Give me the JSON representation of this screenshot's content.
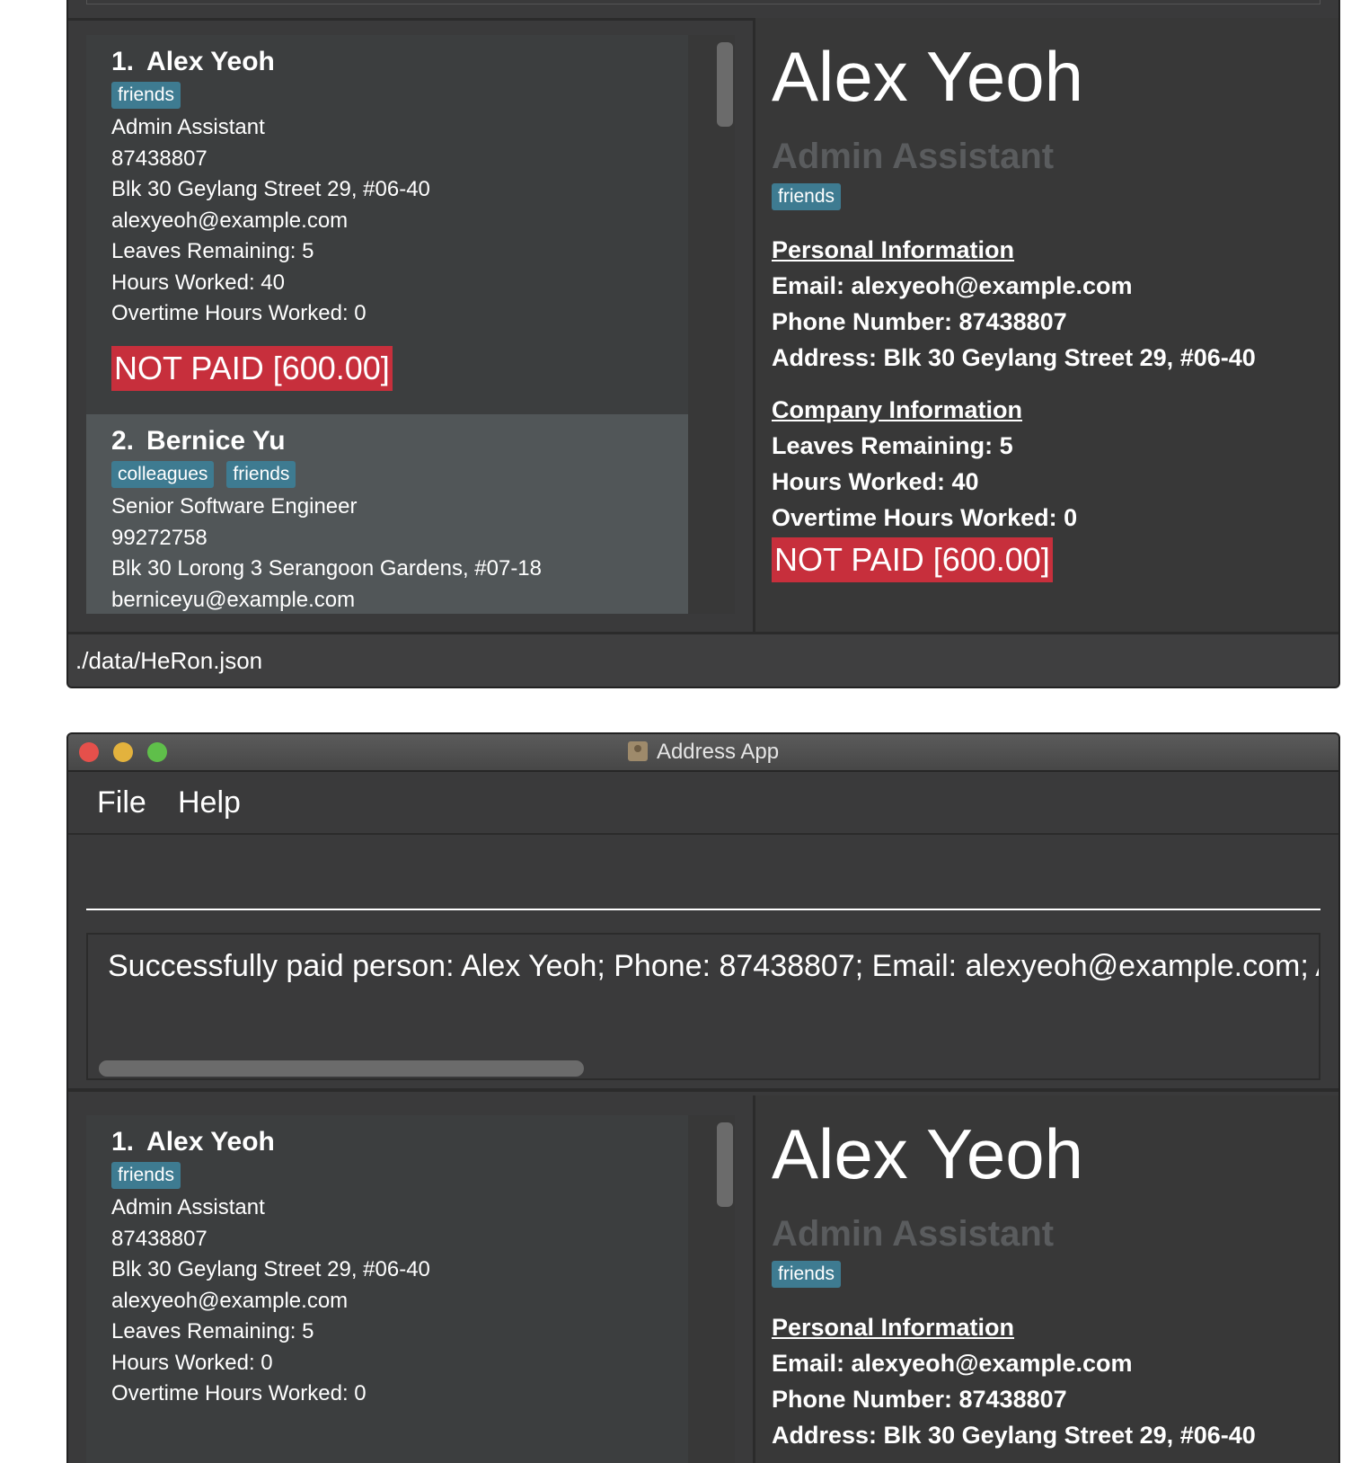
{
  "top_window": {
    "list": [
      {
        "index": "1.",
        "name": "Alex Yeoh",
        "tags": [
          "friends"
        ],
        "role": "Admin Assistant",
        "phone": "87438807",
        "address": "Blk 30 Geylang Street 29, #06-40",
        "email": "alexyeoh@example.com",
        "leaves": "Leaves Remaining: 5",
        "hours": "Hours Worked: 40",
        "overtime": "Overtime Hours Worked: 0",
        "pay_status": "NOT PAID [600.00]"
      },
      {
        "index": "2.",
        "name": "Bernice Yu",
        "tags": [
          "colleagues",
          "friends"
        ],
        "role": "Senior Software Engineer",
        "phone": "99272758",
        "address": "Blk 30 Lorong 3 Serangoon Gardens, #07-18",
        "email": "berniceyu@example.com"
      }
    ],
    "detail": {
      "name": "Alex Yeoh",
      "role": "Admin Assistant",
      "tags": [
        "friends"
      ],
      "personal_title": "Personal Information",
      "email": "Email: alexyeoh@example.com",
      "phone": "Phone Number: 87438807",
      "address": "Address: Blk 30 Geylang Street 29, #06-40",
      "company_title": "Company Information",
      "leaves": "Leaves Remaining: 5",
      "hours": "Hours Worked: 40",
      "overtime": "Overtime Hours Worked: 0",
      "pay_status": "NOT PAID [600.00]"
    },
    "status_path": "./data/HeRon.json"
  },
  "bottom_window": {
    "title": "Address App",
    "menu": [
      "File",
      "Help"
    ],
    "command_value": "",
    "result": "Successfully paid person: Alex Yeoh; Phone: 87438807; Email: alexyeoh@example.com; Add",
    "list": [
      {
        "index": "1.",
        "name": "Alex Yeoh",
        "tags": [
          "friends"
        ],
        "role": "Admin Assistant",
        "phone": "87438807",
        "address": "Blk 30 Geylang Street 29, #06-40",
        "email": "alexyeoh@example.com",
        "leaves": "Leaves Remaining: 5",
        "hours": "Hours Worked: 0",
        "overtime": "Overtime Hours Worked: 0"
      }
    ],
    "detail": {
      "name": "Alex Yeoh",
      "role": "Admin Assistant",
      "tags": [
        "friends"
      ],
      "personal_title": "Personal Information",
      "email": "Email: alexyeoh@example.com",
      "phone": "Phone Number: 87438807",
      "address": "Address: Blk 30 Geylang Street 29, #06-40"
    }
  },
  "colors": {
    "background": "#3a3a3b",
    "tag": "#3e7b91",
    "not_paid": "#c72f3c",
    "selected_row": "#515658"
  },
  "icons": [
    "close-window-icon",
    "minimize-window-icon",
    "zoom-window-icon",
    "address-book-app-icon"
  ]
}
